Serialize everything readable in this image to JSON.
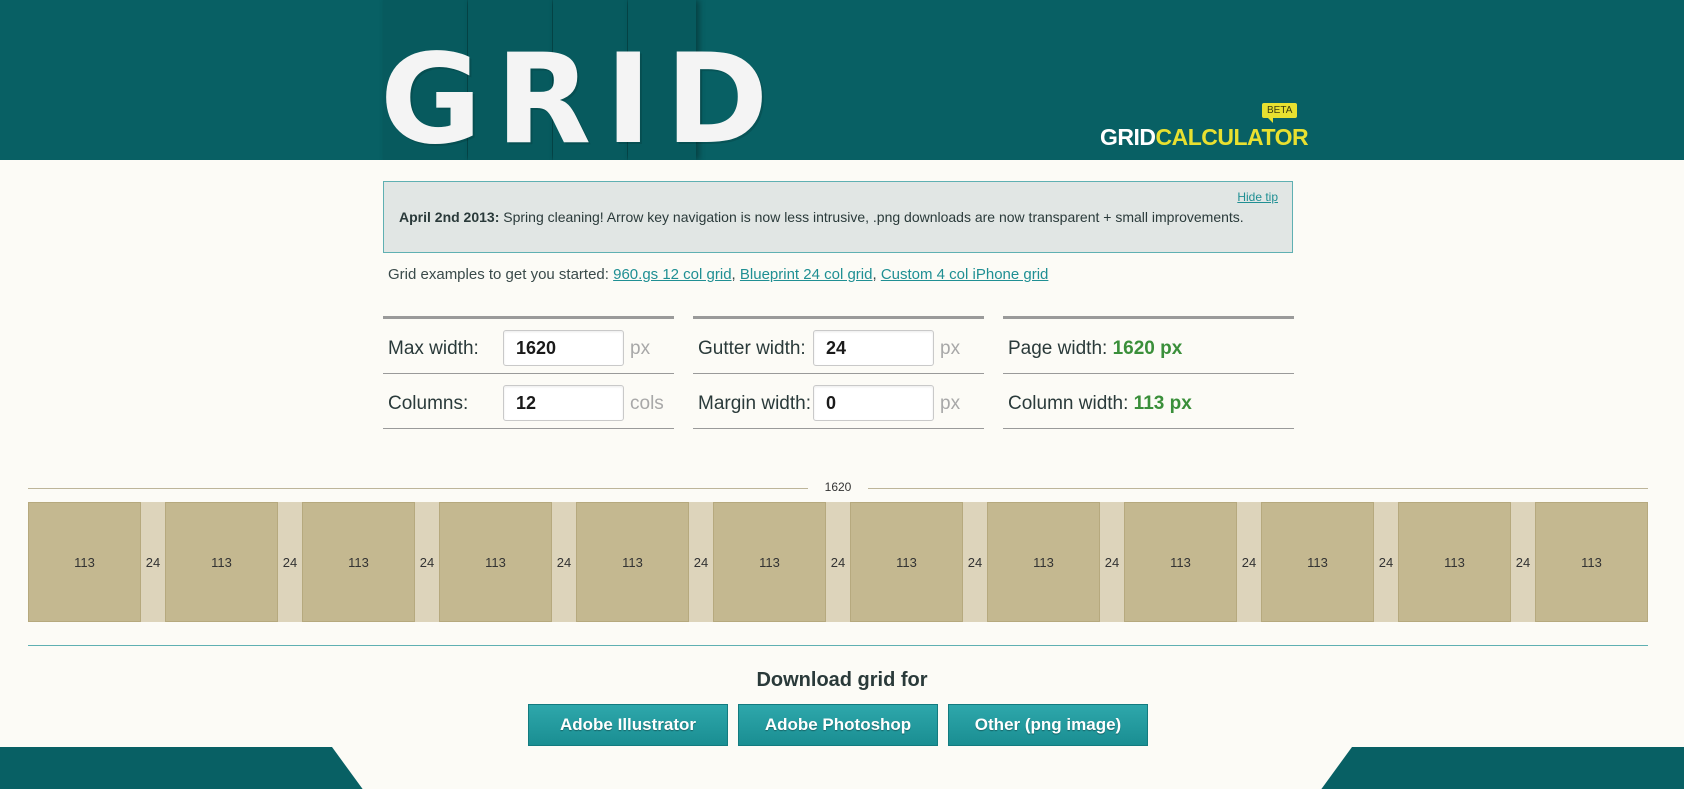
{
  "header": {
    "logo": "GRID",
    "brand_white": "GRID",
    "brand_yellow": "CALCULATOR",
    "badge": "BETA",
    "colors": {
      "header_bg": "#086064",
      "brand_yellow": "#e8e030"
    }
  },
  "tip": {
    "hide_label": "Hide tip",
    "date": "April 2nd 2013:",
    "message": "Spring cleaning! Arrow key navigation is now less intrusive, .png downloads are now transparent + small improvements."
  },
  "examples": {
    "intro": "Grid examples to get you started:",
    "links": [
      "960.gs 12 col grid",
      "Blueprint 24 col grid",
      "Custom 4 col iPhone grid"
    ],
    "sep": ","
  },
  "form": {
    "max_width": {
      "label": "Max width:",
      "value": "1620",
      "unit": "px"
    },
    "columns": {
      "label": "Columns:",
      "value": "12",
      "unit": "cols"
    },
    "gutter_width": {
      "label": "Gutter width:",
      "value": "24",
      "unit": "px"
    },
    "margin_width": {
      "label": "Margin width:",
      "value": "0",
      "unit": "px"
    },
    "page_width": {
      "label": "Page width:",
      "value": "1620 px"
    },
    "column_width": {
      "label": "Column width:",
      "value": "113 px"
    }
  },
  "grid": {
    "total_label": "1620",
    "column_count": 12,
    "column_label": "113",
    "gutter_label": "24"
  },
  "download": {
    "title": "Download grid for",
    "buttons": [
      "Adobe Illustrator",
      "Adobe Photoshop",
      "Other (png image)"
    ]
  }
}
